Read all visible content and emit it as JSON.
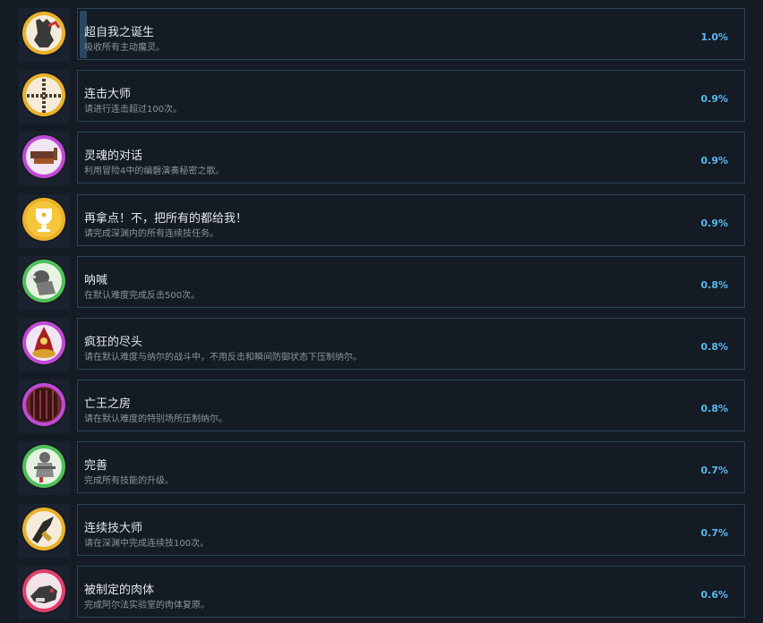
{
  "achievements": [
    {
      "title": "超自我之诞生",
      "desc": "吸收所有主动魔灵。",
      "percent": "1.0%",
      "progress": 1.0,
      "ring": "#e9b22a",
      "bg": "#f4ecd9",
      "accent": "#3a3a3a",
      "icon": "demon-figure-icon"
    },
    {
      "title": "连击大师",
      "desc": "请进行连击超过100次。",
      "percent": "0.9%",
      "progress": 0.9,
      "ring": "#e9b22a",
      "bg": "#f4ecd9",
      "accent": "#4a3b2a",
      "icon": "cross-chain-icon"
    },
    {
      "title": "灵魂的对话",
      "desc": "利用冒险4中的编磬演奏秘密之歌。",
      "percent": "0.9%",
      "progress": 0.9,
      "ring": "#c04ad6",
      "bg": "#f1e6f3",
      "accent": "#6b3a2a",
      "icon": "instrument-icon"
    },
    {
      "title": "再拿点！不，把所有的都给我！",
      "desc": "请完成深渊内的所有连续技任务。",
      "percent": "0.9%",
      "progress": 0.9,
      "ring": "#e9b22a",
      "bg": "#f6c63a",
      "accent": "#ffffff",
      "icon": "trophy-icon"
    },
    {
      "title": "呐喊",
      "desc": "在默认难度完成反击500次。",
      "percent": "0.8%",
      "progress": 0.8,
      "ring": "#4fc05a",
      "bg": "#e7f3e2",
      "accent": "#5a5a5a",
      "icon": "shouting-figure-icon"
    },
    {
      "title": "疯狂的尽头",
      "desc": "请在默认难度与纳尔的战斗中，不用反击和瞬间防御状态下压制纳尔。",
      "percent": "0.8%",
      "progress": 0.8,
      "ring": "#c04ad6",
      "bg": "#f1e6f3",
      "accent": "#a8201a",
      "icon": "fire-boss-icon"
    },
    {
      "title": "亡王之房",
      "desc": "请在默认难度的特别场所压制纳尔。",
      "percent": "0.8%",
      "progress": 0.8,
      "ring": "#c04ad6",
      "bg": "#6b2a2a",
      "accent": "#3a1414",
      "icon": "door-icon"
    },
    {
      "title": "完善",
      "desc": "完成所有技能的升级。",
      "percent": "0.7%",
      "progress": 0.7,
      "ring": "#4fc05a",
      "bg": "#e7f3e2",
      "accent": "#6a6a6a",
      "icon": "warrior-icon"
    },
    {
      "title": "连续技大师",
      "desc": "请在深渊中完成连续技100次。",
      "percent": "0.7%",
      "progress": 0.7,
      "ring": "#e9b22a",
      "bg": "#f4ecd9",
      "accent": "#2a2a2a",
      "icon": "dark-slash-icon"
    },
    {
      "title": "被制定的肉体",
      "desc": "完成阿尔法实验室的肉体复原。",
      "percent": "0.6%",
      "progress": 0.6,
      "ring": "#e0406a",
      "bg": "#f3e3e8",
      "accent": "#3a3a3a",
      "icon": "creature-icon"
    }
  ]
}
